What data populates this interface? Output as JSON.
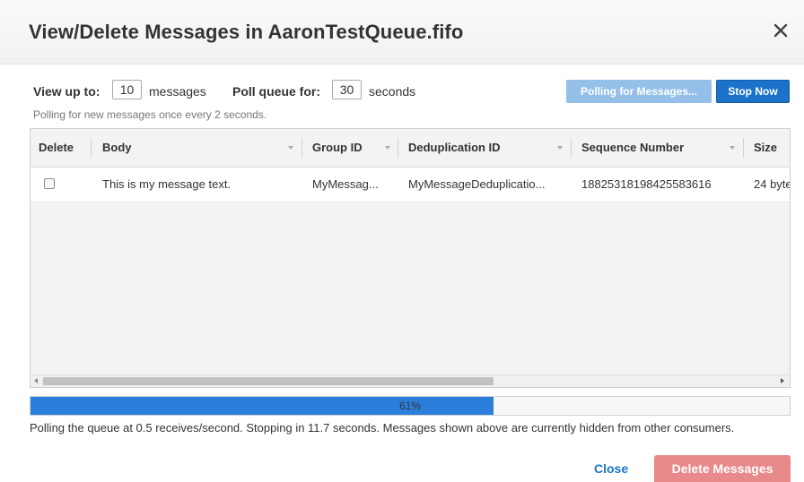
{
  "dialog": {
    "title": "View/Delete Messages in AaronTestQueue.fifo",
    "close_icon": "close-icon"
  },
  "controls": {
    "view_up_to_label": "View up to:",
    "view_up_to_value": "10",
    "view_up_to_unit": "messages",
    "poll_queue_label": "Poll queue for:",
    "poll_queue_value": "30",
    "poll_queue_unit": "seconds",
    "polling_hint": "Polling for new messages once every 2 seconds.",
    "polling_button": "Polling for Messages...",
    "stop_button": "Stop Now"
  },
  "table": {
    "columns": [
      "Delete",
      "Body",
      "Group ID",
      "Deduplication ID",
      "Sequence Number",
      "Size"
    ],
    "rows": [
      {
        "checked": false,
        "body": "This is my message text.",
        "group_id": "MyMessag...",
        "deduplication_id": "MyMessageDeduplicatio...",
        "sequence_number": "18825318198425583616",
        "size": "24 byte"
      }
    ]
  },
  "progress": {
    "percent": 61,
    "label": "61%"
  },
  "status_text": "Polling the queue at 0.5 receives/second. Stopping in 11.7 seconds. Messages shown above are currently hidden from other consumers.",
  "footer": {
    "close_label": "Close",
    "delete_label": "Delete Messages"
  },
  "colors": {
    "primary": "#1a73c9",
    "disabled_primary": "#93bfe8",
    "progress_fill": "#2b7fdb",
    "delete_disabled": "#e8898b"
  }
}
